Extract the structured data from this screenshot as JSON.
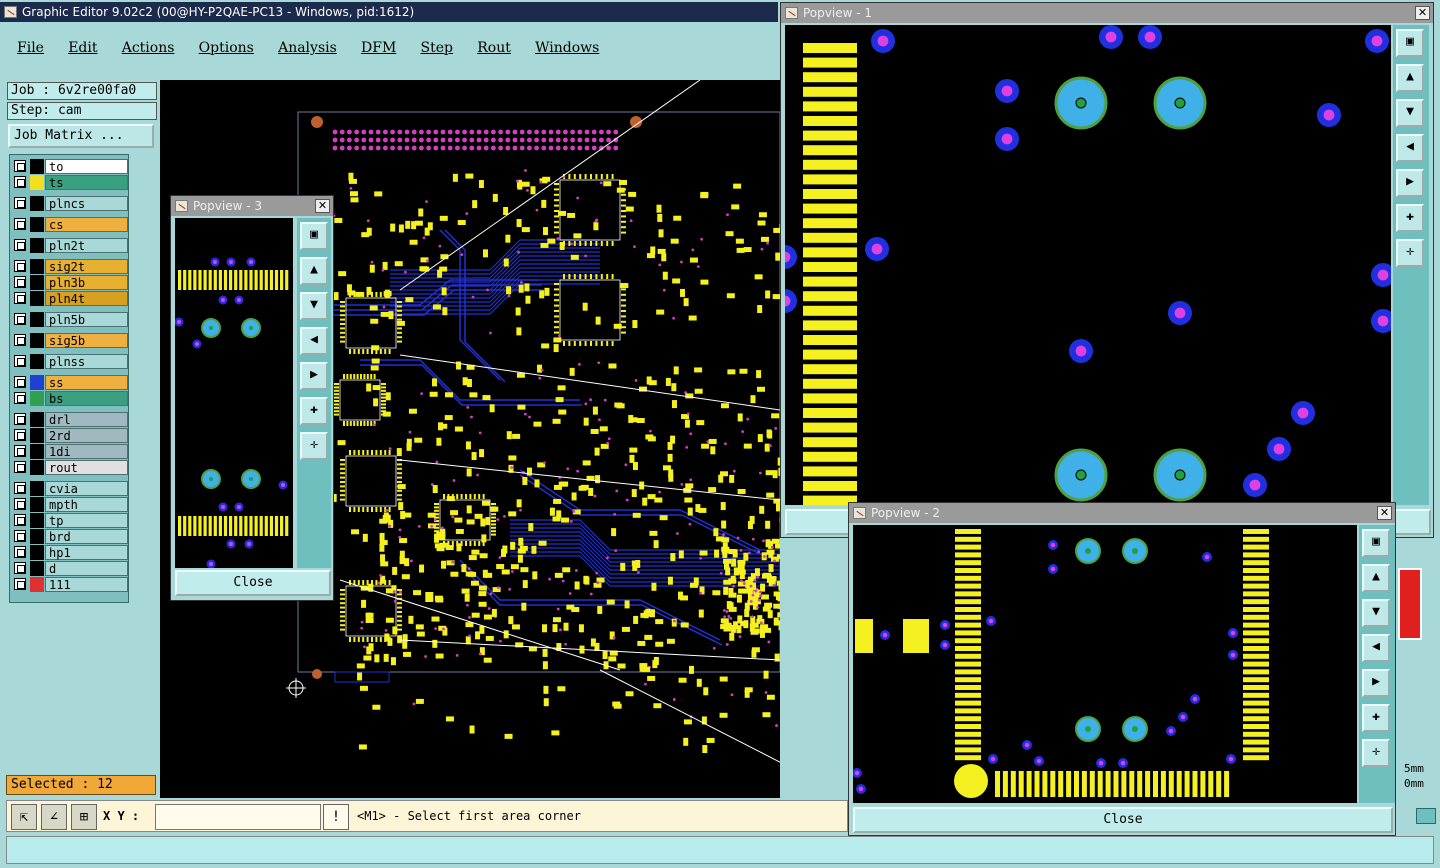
{
  "main_window": {
    "title": "Graphic Editor 9.02c2 (00@HY-P2QAE-PC13 - Windows, pid:1612)"
  },
  "menu": [
    {
      "label": "File"
    },
    {
      "label": "Edit"
    },
    {
      "label": "Actions"
    },
    {
      "label": "Options"
    },
    {
      "label": "Analysis"
    },
    {
      "label": "DFM"
    },
    {
      "label": "Step"
    },
    {
      "label": "Rout"
    },
    {
      "label": "Windows"
    }
  ],
  "job": {
    "job_label": "Job : 6v2re00fa0",
    "step_label": "Step: cam",
    "matrix_button": "Job Matrix ..."
  },
  "layers": [
    {
      "name": "to",
      "color": "#ffffff",
      "swatch": "#000000"
    },
    {
      "name": "ts",
      "color": "#3aa080",
      "swatch": "#f0e020"
    },
    {
      "name": "plncs",
      "color": "#a8d8d8",
      "swatch": "#000000"
    },
    {
      "name": "cs",
      "color": "#f0b040",
      "swatch": "#000000"
    },
    {
      "name": "pln2t",
      "color": "#a8d8d8",
      "swatch": "#000000"
    },
    {
      "name": "sig2t",
      "color": "#e8b030",
      "swatch": "#000000"
    },
    {
      "name": "pln3b",
      "color": "#e8b030",
      "swatch": "#000000"
    },
    {
      "name": "pln4t",
      "color": "#d8a020",
      "swatch": "#000000"
    },
    {
      "name": "pln5b",
      "color": "#a8d8d8",
      "swatch": "#000000"
    },
    {
      "name": "sig5b",
      "color": "#f0b040",
      "swatch": "#000000"
    },
    {
      "name": "plnss",
      "color": "#a8d8d8",
      "swatch": "#000000"
    },
    {
      "name": "ss",
      "color": "#f0b040",
      "swatch": "#2040d0"
    },
    {
      "name": "bs",
      "color": "#3aa080",
      "swatch": "#30a050"
    },
    {
      "name": "drl",
      "color": "#a0b8c0",
      "swatch": "#000000"
    },
    {
      "name": "2rd",
      "color": "#a0b8c0",
      "swatch": "#000000"
    },
    {
      "name": "1di",
      "color": "#a0b8c0",
      "swatch": "#000000"
    },
    {
      "name": "rout",
      "color": "#e0e0e0",
      "swatch": "#000000"
    },
    {
      "name": "cvia",
      "color": "#a8d8d8",
      "swatch": "#000000"
    },
    {
      "name": "mpth",
      "color": "#a8d8d8",
      "swatch": "#000000"
    },
    {
      "name": "tp",
      "color": "#a8d8d8",
      "swatch": "#000000"
    },
    {
      "name": "brd",
      "color": "#a8d8d8",
      "swatch": "#000000"
    },
    {
      "name": "hp1",
      "color": "#a8d8d8",
      "swatch": "#000000"
    },
    {
      "name": "d",
      "color": "#a8d8d8",
      "swatch": "#000000"
    },
    {
      "name": "111",
      "color": "#a8d8d8",
      "swatch": "#e03030"
    }
  ],
  "status": {
    "selected": "Selected : 12"
  },
  "command": {
    "xy_label": "X Y :",
    "xy_value": "",
    "prompt": "<M1> - Select first area corner"
  },
  "popviews": {
    "p1": {
      "title": "Popview - 1"
    },
    "p2": {
      "title": "Popview - 2",
      "close": "Close"
    },
    "p3": {
      "title": "Popview - 3",
      "close": "Close"
    }
  },
  "right_edge": {
    "unit1": "5mm",
    "unit2": "0mm"
  },
  "colors": {
    "pad": "#f5f020",
    "trace": "#2030d0",
    "via_ring": "#2030e0",
    "via_hole": "#e040e0",
    "big_pad": "#40b0e8",
    "big_pad_ring": "#50a040",
    "big_pad_hole": "#20a040",
    "titlebar_active": "#1c2a4c"
  }
}
